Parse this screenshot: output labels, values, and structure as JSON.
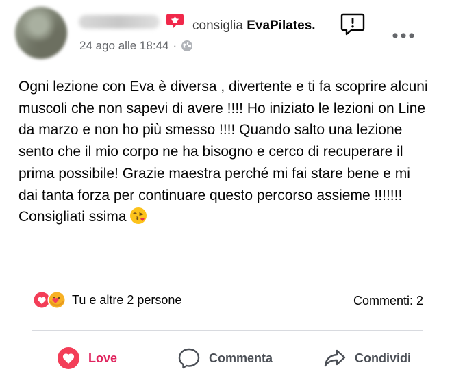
{
  "post": {
    "header": {
      "verb": "consiglia",
      "page_name": "EvaPilates.",
      "timestamp": "24 ago alle 18:44",
      "separator": "·"
    },
    "body": "Ogni lezione con Eva è diversa , divertente e ti fa scoprire alcuni muscoli che non sapevi di avere !!!! Ho iniziato le lezioni on Line da marzo e non ho più smesso !!!! Quando salto una lezione sento che il mio corpo ne ha bisogno e cerco di recuperare il prima possibile! Grazie maestra perché mi fai stare bene e mi dai tanta forza per continuare questo percorso assieme !!!!!!! Consigliati ssima",
    "body_emoji": "face-blowing-kiss-icon",
    "reactions_text": "Tu e altre 2 persone",
    "comments_text": "Commenti: 2"
  },
  "actions": {
    "love": "Love",
    "comment": "Commenta",
    "share": "Condividi"
  },
  "colors": {
    "recommend_badge": "#f0284a",
    "love": "#e0245e",
    "meta_text": "#65676b",
    "action_text": "#4b4f56",
    "divider": "#d8dadf"
  }
}
